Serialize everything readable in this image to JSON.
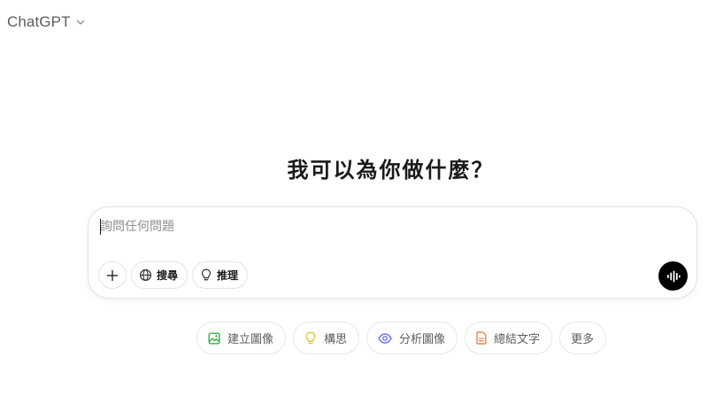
{
  "header": {
    "model_name": "ChatGPT",
    "model_dropdown_icon": "chevron-down-icon"
  },
  "main": {
    "heading": "我可以為你做什麼？"
  },
  "composer": {
    "input_value": "",
    "placeholder": "詢問任何問題",
    "add_icon": "plus-icon",
    "tools": [
      {
        "label": "搜尋",
        "icon": "globe-icon"
      },
      {
        "label": "推理",
        "icon": "lightbulb-icon"
      }
    ],
    "voice_icon": "voice-waveform-icon"
  },
  "suggestions": [
    {
      "label": "建立圖像",
      "icon": "image-icon",
      "color": "#35ae47"
    },
    {
      "label": "構思",
      "icon": "lightbulb-icon",
      "color": "#e2c541"
    },
    {
      "label": "分析圖像",
      "icon": "eye-icon",
      "color": "#6c71ff"
    },
    {
      "label": "總結文字",
      "icon": "document-icon",
      "color": "#ea8444"
    },
    {
      "label": "更多",
      "icon": "",
      "color": ""
    }
  ]
}
